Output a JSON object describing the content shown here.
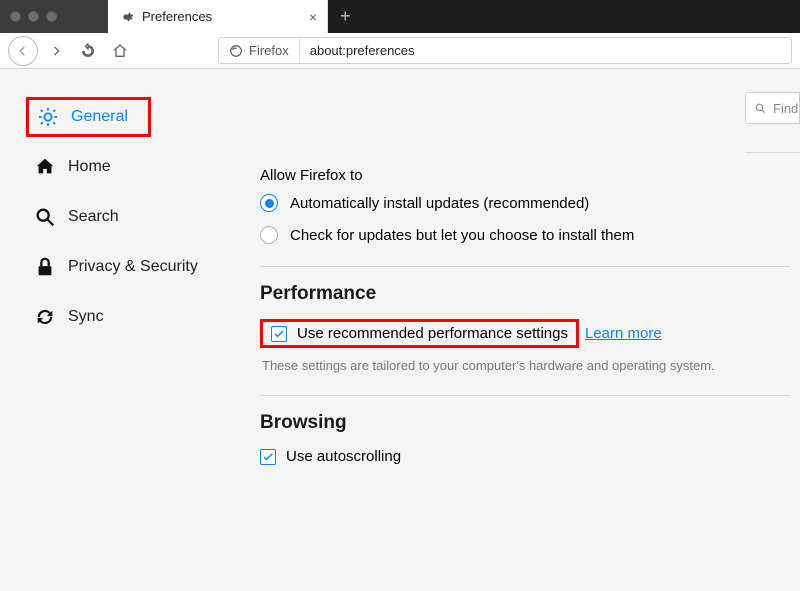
{
  "window": {
    "tab_title": "Preferences"
  },
  "urlbar": {
    "identity": "Firefox",
    "url": "about:preferences"
  },
  "findbar": {
    "placeholder": "Find"
  },
  "sidebar": {
    "items": [
      {
        "label": "General"
      },
      {
        "label": "Home"
      },
      {
        "label": "Search"
      },
      {
        "label": "Privacy & Security"
      },
      {
        "label": "Sync"
      }
    ]
  },
  "updates": {
    "allow_label": "Allow Firefox to",
    "option_auto": "Automatically install updates (recommended)",
    "option_manual": "Check for updates but let you choose to install them"
  },
  "performance": {
    "heading": "Performance",
    "checkbox_label": "Use recommended performance settings",
    "learn_more": "Learn more",
    "description": "These settings are tailored to your computer's hardware and operating system."
  },
  "browsing": {
    "heading": "Browsing",
    "autoscroll": "Use autoscrolling"
  }
}
